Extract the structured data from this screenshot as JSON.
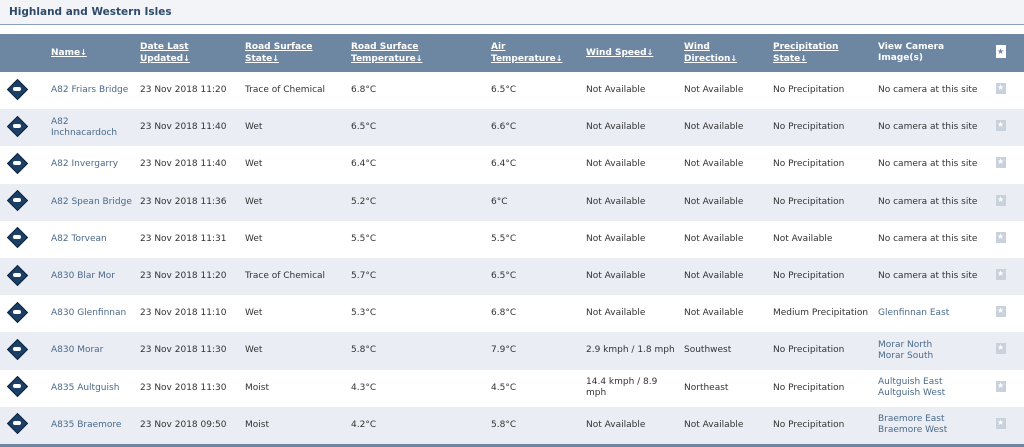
{
  "region": {
    "title": "Highland and Western Isles"
  },
  "headers": {
    "name": [
      "Name"
    ],
    "date": [
      "Date Last",
      "Updated"
    ],
    "surface_state": [
      "Road Surface",
      "State"
    ],
    "surface_temp": [
      "Road Surface",
      "Temperature"
    ],
    "air_temp": [
      "Air",
      "Temperature"
    ],
    "wind_speed": [
      "Wind Speed"
    ],
    "wind_dir": [
      "Wind",
      "Direction"
    ],
    "precip": [
      "Precipitation",
      "State"
    ],
    "camera": [
      "View Camera",
      "Image(s)"
    ],
    "sort_arrow": "↓"
  },
  "rows": [
    {
      "name": "A82 Friars Bridge",
      "date": "23 Nov 2018 11:20",
      "surface_state": "Trace of Chemical",
      "surface_temp": "6.8°C",
      "air_temp": "6.5°C",
      "wind_speed": "Not Available",
      "wind_dir": "Not Available",
      "precip": "No Precipitation",
      "camera": [
        "No camera at this site"
      ],
      "camera_link": false
    },
    {
      "name": "A82 Inchnacardoch",
      "date": "23 Nov 2018 11:40",
      "surface_state": "Wet",
      "surface_temp": "6.5°C",
      "air_temp": "6.6°C",
      "wind_speed": "Not Available",
      "wind_dir": "Not Available",
      "precip": "No Precipitation",
      "camera": [
        "No camera at this site"
      ],
      "camera_link": false
    },
    {
      "name": "A82 Invergarry",
      "date": "23 Nov 2018 11:40",
      "surface_state": "Wet",
      "surface_temp": "6.4°C",
      "air_temp": "6.4°C",
      "wind_speed": "Not Available",
      "wind_dir": "Not Available",
      "precip": "No Precipitation",
      "camera": [
        "No camera at this site"
      ],
      "camera_link": false
    },
    {
      "name": "A82 Spean Bridge",
      "date": "23 Nov 2018 11:36",
      "surface_state": "Wet",
      "surface_temp": "5.2°C",
      "air_temp": "6°C",
      "wind_speed": "Not Available",
      "wind_dir": "Not Available",
      "precip": "No Precipitation",
      "camera": [
        "No camera at this site"
      ],
      "camera_link": false
    },
    {
      "name": "A82 Torvean",
      "date": "23 Nov 2018 11:31",
      "surface_state": "Wet",
      "surface_temp": "5.5°C",
      "air_temp": "5.5°C",
      "wind_speed": "Not Available",
      "wind_dir": "Not Available",
      "precip": "Not Available",
      "camera": [
        "No camera at this site"
      ],
      "camera_link": false
    },
    {
      "name": "A830 Blar Mor",
      "date": "23 Nov 2018 11:20",
      "surface_state": "Trace of Chemical",
      "surface_temp": "5.7°C",
      "air_temp": "6.5°C",
      "wind_speed": "Not Available",
      "wind_dir": "Not Available",
      "precip": "No Precipitation",
      "camera": [
        "No camera at this site"
      ],
      "camera_link": false
    },
    {
      "name": "A830 Glenfinnan",
      "date": "23 Nov 2018 11:10",
      "surface_state": "Wet",
      "surface_temp": "5.3°C",
      "air_temp": "6.8°C",
      "wind_speed": "Not Available",
      "wind_dir": "Not Available",
      "precip": "Medium Precipitation",
      "camera": [
        "Glenfinnan East"
      ],
      "camera_link": true
    },
    {
      "name": "A830 Morar",
      "date": "23 Nov 2018 11:30",
      "surface_state": "Wet",
      "surface_temp": "5.8°C",
      "air_temp": "7.9°C",
      "wind_speed": "2.9 kmph / 1.8 mph",
      "wind_dir": "Southwest",
      "precip": "No Precipitation",
      "camera": [
        "Morar North",
        "Morar South"
      ],
      "camera_link": true
    },
    {
      "name": "A835 Aultguish",
      "date": "23 Nov 2018 11:30",
      "surface_state": "Moist",
      "surface_temp": "4.3°C",
      "air_temp": "4.5°C",
      "wind_speed": "14.4 kmph / 8.9 mph",
      "wind_dir": "Northeast",
      "precip": "No Precipitation",
      "camera": [
        "Aultguish East",
        "Aultguish West"
      ],
      "camera_link": true
    },
    {
      "name": "A835 Braemore",
      "date": "23 Nov 2018 09:50",
      "surface_state": "Moist",
      "surface_temp": "4.2°C",
      "air_temp": "5.8°C",
      "wind_speed": "Not Available",
      "wind_dir": "Not Available",
      "precip": "No Precipitation",
      "camera": [
        "Braemore East",
        "Braemore West"
      ],
      "camera_link": true
    }
  ],
  "colors": {
    "header_bg": "#6d87a3",
    "row_alt": "#eaedf3",
    "link": "#4a6a8a",
    "icon": "#1c3f66"
  },
  "icons": {
    "site": "road-sensor-diamond-icon",
    "favourite": "star-bookmark-icon"
  }
}
